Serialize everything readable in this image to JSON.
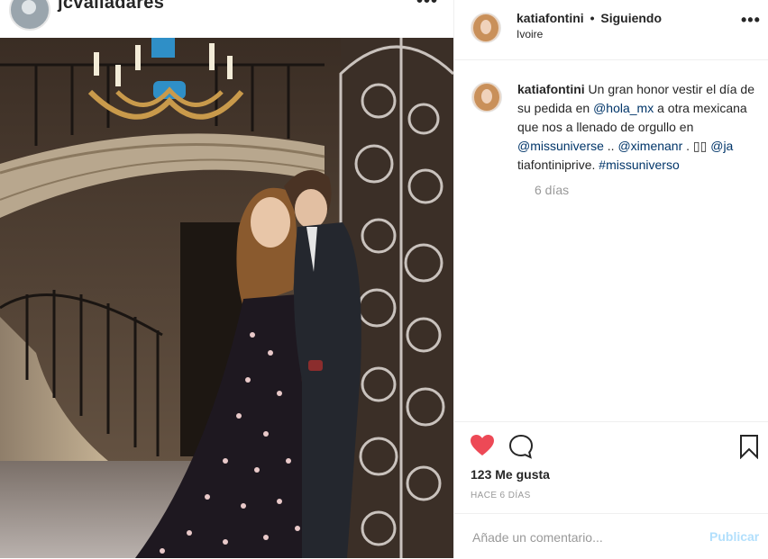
{
  "background_post": {
    "username": "jcvalladares",
    "more_icon": "ellipsis-icon"
  },
  "post": {
    "username": "katiafontini",
    "separator": "•",
    "follow_status": "Siguiendo",
    "location": "Ivoire",
    "more_icon": "ellipsis-icon"
  },
  "caption": {
    "username": "katiafontini",
    "text_1": " Un gran honor vestir el día de su pedida en ",
    "mention_1": "@hola_mx",
    "text_2": " a otra mexicana que nos a llenado de orgullo en ",
    "mention_2": "@missuniverse",
    "text_3": " .. ",
    "mention_3": "@ximenanr",
    "text_4": " . ▯▯ ",
    "mention_4": "@ja",
    "text_5": " tiafontiniprive. ",
    "hashtag_1": "#missuniverso",
    "time": "6 días"
  },
  "actions": {
    "like_icon": "heart-filled-icon",
    "comment_icon": "comment-icon",
    "save_icon": "bookmark-icon",
    "likes_label": "123 Me gusta",
    "time_ago": "HACE 6 DÍAS",
    "like_color": "#ed4956"
  },
  "comment": {
    "placeholder": "Añade un comentario...",
    "publish_label": "Publicar",
    "publish_color": "#b2dffc"
  }
}
